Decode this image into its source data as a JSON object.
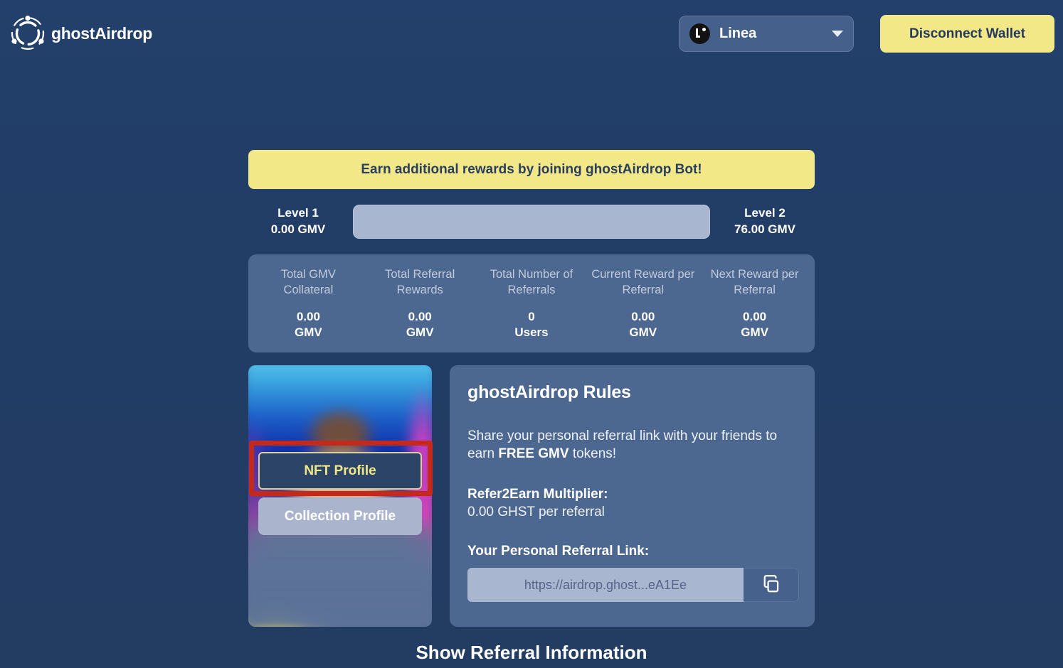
{
  "header": {
    "brand_name": "ghostAirdrop",
    "brand_logo_icon": "ghost-airdrop-logo-icon",
    "network": {
      "label": "Linea",
      "icon": "linea-network-icon",
      "caret_icon": "chevron-down-icon"
    },
    "disconnect_label": "Disconnect Wallet"
  },
  "promo": {
    "banner_text": "Earn additional rewards by joining ghostAirdrop Bot!"
  },
  "level": {
    "left_title": "Level 1",
    "left_value": "0.00 GMV",
    "right_title": "Level 2",
    "right_value": "76.00 GMV",
    "progress_percent": 0
  },
  "stats": [
    {
      "label": "Total GMV Collateral",
      "value": "0.00",
      "unit": "GMV"
    },
    {
      "label": "Total Referral Rewards",
      "value": "0.00",
      "unit": "GMV"
    },
    {
      "label": "Total Number of Referrals",
      "value": "0",
      "unit": "Users"
    },
    {
      "label": "Current Reward per Referral",
      "value": "0.00",
      "unit": "GMV"
    },
    {
      "label": "Next Reward per Referral",
      "value": "0.00",
      "unit": "GMV"
    }
  ],
  "nft_card": {
    "nft_profile_label": "NFT Profile",
    "collection_profile_label": "Collection Profile",
    "highlight_color": "#c32a1c"
  },
  "rules": {
    "title": "ghostAirdrop Rules",
    "body_prefix": "Share your personal referral link with your friends to earn ",
    "body_emphasis": "FREE GMV",
    "body_suffix": " tokens!",
    "multiplier_title": "Refer2Earn Multiplier:",
    "multiplier_value": "0.00 GHST per referral",
    "referral_title": "Your Personal Referral Link:",
    "referral_link": "https://airdrop.ghost...eA1Ee",
    "copy_icon": "copy-icon"
  },
  "footer": {
    "show_referral_label": "Show Referral Information"
  },
  "colors": {
    "background": "#223d66",
    "panel": "#4d6890",
    "accent_yellow": "#f2e888",
    "light_track": "#a8b6d0",
    "highlight_red": "#c32a1c"
  }
}
